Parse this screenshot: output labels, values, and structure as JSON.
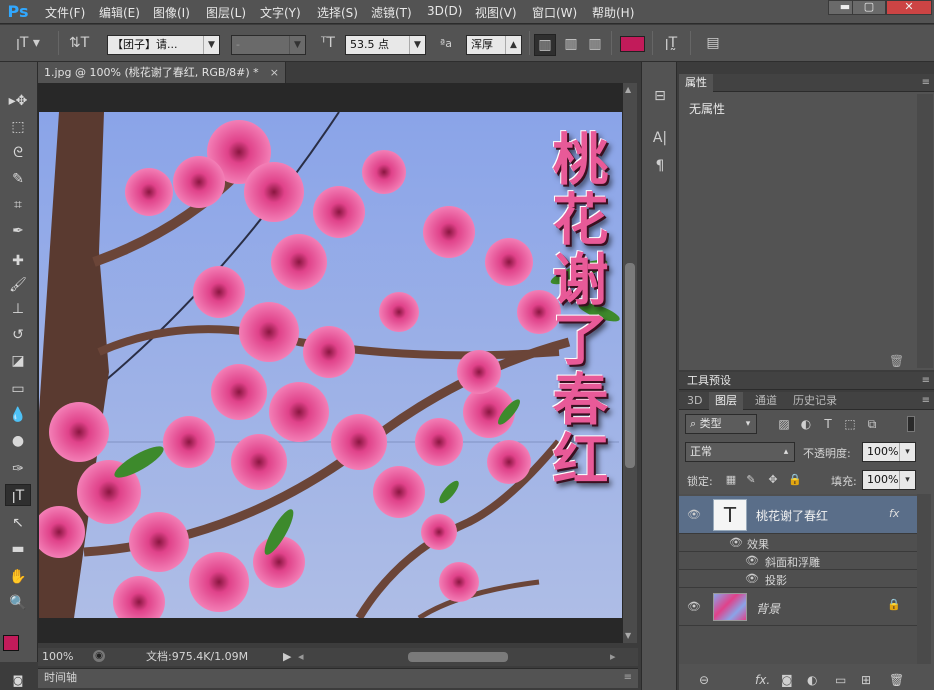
{
  "app": {
    "logo": "Ps"
  },
  "menu": [
    "文件(F)",
    "编辑(E)",
    "图像(I)",
    "图层(L)",
    "文字(Y)",
    "选择(S)",
    "滤镜(T)",
    "3D(D)",
    "视图(V)",
    "窗口(W)",
    "帮助(H)"
  ],
  "window_controls": {
    "minimize": "▬",
    "maximize": "▢",
    "close": "✕"
  },
  "options": {
    "tool_icon": "type-tool-icon",
    "font_family": "【团子】请...",
    "font_style": "-",
    "font_size": "53.5 点",
    "aa_label": "ªa",
    "anti_alias": "浑厚",
    "text_color": "#c21b5a"
  },
  "document": {
    "tab_title": "1.jpg @ 100% (桃花谢了春红, RGB/8#) *",
    "text_layer_content": "桃花谢了春红"
  },
  "status": {
    "zoom": "100%",
    "doc_info": "文档:975.4K/1.09M"
  },
  "timeline": {
    "label": "时间轴"
  },
  "properties_panel": {
    "tab": "属性",
    "content": "无属性"
  },
  "tool_presets_panel": {
    "tab": "工具预设"
  },
  "layers_panel": {
    "tabs": [
      "3D",
      "图层",
      "通道",
      "历史记录"
    ],
    "filter_kind": "类型",
    "blend_mode": "正常",
    "opacity_label": "不透明度:",
    "opacity_value": "100%",
    "lock_label": "锁定:",
    "fill_label": "填充:",
    "fill_value": "100%",
    "layers": [
      {
        "name": "桃花谢了春红",
        "type": "text",
        "fx": "fx"
      },
      {
        "name": "背景",
        "type": "image"
      }
    ],
    "effects_label": "效果",
    "effects": [
      "斜面和浮雕",
      "投影"
    ]
  },
  "colors": {
    "foreground": "#c21b5a",
    "background": "#ffffff",
    "accent_text": "#c21b5a"
  }
}
